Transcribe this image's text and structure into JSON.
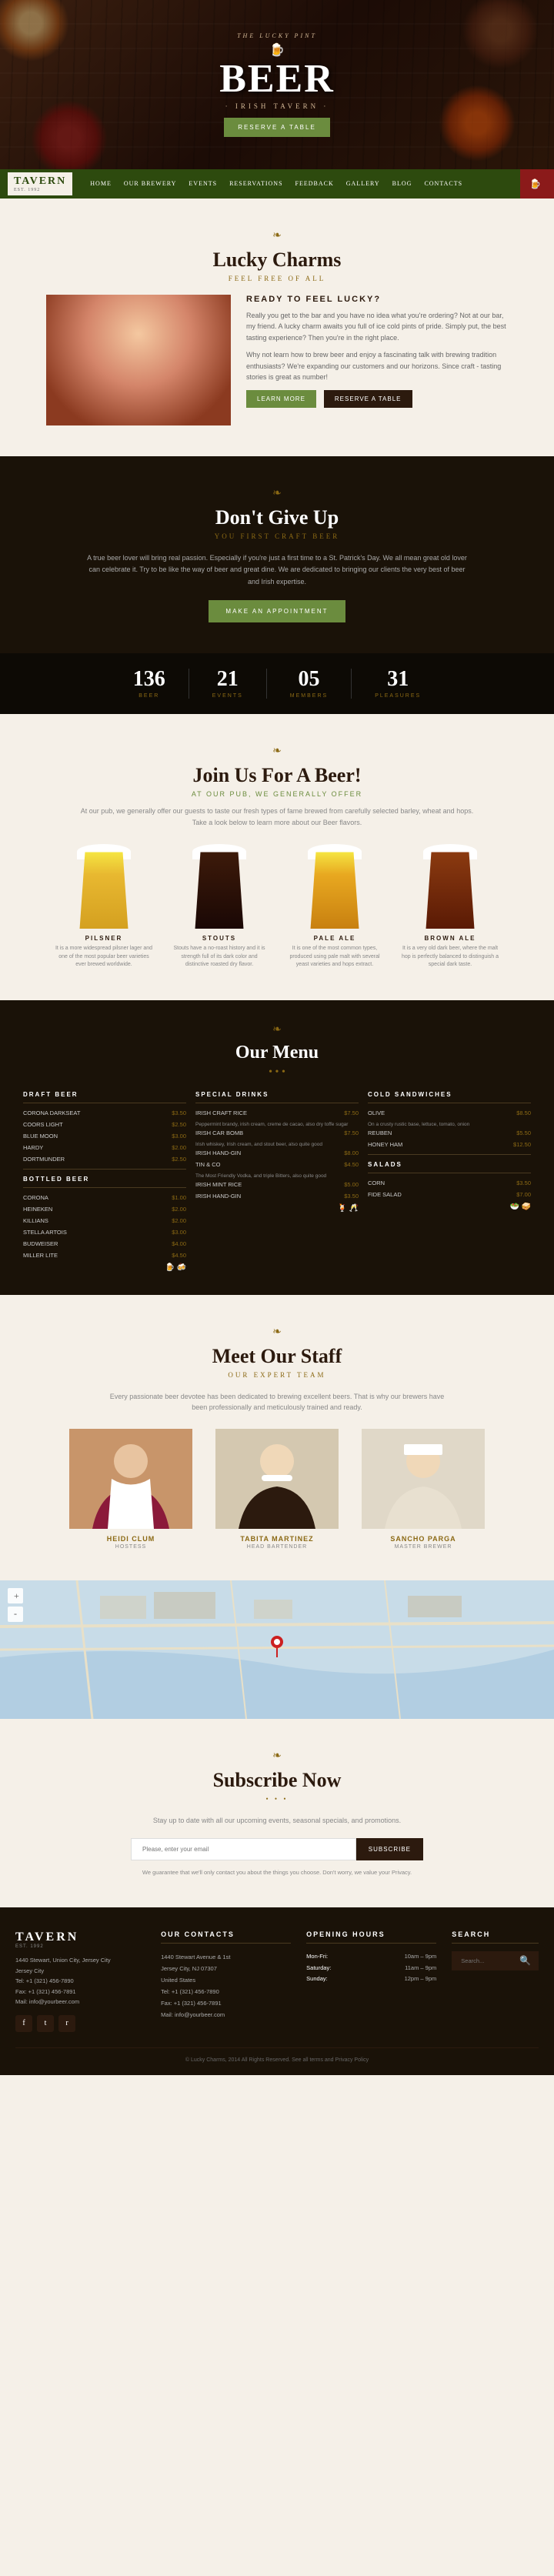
{
  "hero": {
    "brand_line": "THE LUCKY PINT",
    "title": "BEER",
    "subtitle": "· IRISH TAVERN ·",
    "cta_button": "RESERVE A TABLE"
  },
  "nav": {
    "logo": "TAVERN",
    "logo_sub": "EST. 1992",
    "items": [
      {
        "label": "HOME"
      },
      {
        "label": "OUR BREWERY"
      },
      {
        "label": "EVENTS"
      },
      {
        "label": "RESERVATIONS"
      },
      {
        "label": "FEEDBACK"
      },
      {
        "label": "GALLERY"
      },
      {
        "label": "BLOG"
      },
      {
        "label": "CONTACTS"
      }
    ],
    "ribbon": "CONTACTS"
  },
  "lucky_charms": {
    "section_title": "Lucky Charms",
    "section_subtitle": "FEEL FREE OF ALL",
    "ready_title": "READY TO FEEL LUCKY?",
    "paragraph1": "Really you get to the bar and you have no idea what you're ordering? Not at our bar, my friend. A lucky charm awaits you full of ice cold pints of pride. Simply put, the best tasting experience? Then you're in the right place.",
    "paragraph2": "Why not learn how to brew beer and enjoy a fascinating talk with brewing tradition enthusiasts? We're expanding our customers and our horizons. Since craft - tasting stories is great as number!",
    "btn1": "LEARN MORE",
    "btn2": "RESERVE A TABLE"
  },
  "dont_give_up": {
    "section_title": "Don't Give Up",
    "section_subtitle": "YOU FIRST CRAFT BEER",
    "paragraph": "A true beer lover will bring real passion. Especially if you're just a first time to a St. Patrick's Day. We all mean great old lover can celebrate it. Try to be like the way of beer and great dine. We are dedicated to bringing our clients the very best of beer and Irish expertise.",
    "cta_button": "MAKE AN APPOINTMENT"
  },
  "stats": [
    {
      "number": "136",
      "label": "BEER"
    },
    {
      "number": "21",
      "label": "EVENTS"
    },
    {
      "number": "05",
      "label": "MEMBERS"
    },
    {
      "number": "31",
      "label": "PLEASURES"
    }
  ],
  "join_beer": {
    "section_title": "Join Us For A Beer!",
    "section_subtitle": "AT OUR PUB, WE GENERALLY OFFER",
    "description": "At our pub, we generally offer our guests to taste our fresh types of fame brewed from carefully selected barley, wheat and hops. Take a look below to learn more about our Beer flavors.",
    "beers": [
      {
        "name": "PILSNER",
        "type": "pilsner",
        "description": "It is a more widespread pilsner lager and one of the most popular beer varieties ever brewed worldwide."
      },
      {
        "name": "STOUTS",
        "type": "stout",
        "description": "Stouts have a no-roast history and it is strength full of its dark color and distinctive roasted dry flavor."
      },
      {
        "name": "PALE ALE",
        "type": "pale",
        "description": "It is one of the most common types, produced using pale malt with several yeast varieties and hops extract."
      },
      {
        "name": "BROWN ALE",
        "type": "brown",
        "description": "It is a very old dark beer, where the malt hop is perfectly balanced to distinguish a special dark taste."
      }
    ]
  },
  "menu": {
    "section_title": "Our Menu",
    "columns": [
      {
        "title": "DRAFT BEER",
        "items": [
          {
            "name": "CORONA DARKSEAT",
            "price": "$3.50"
          },
          {
            "name": "COORS LIGHT",
            "price": "$2.50"
          },
          {
            "name": "BLUE MOON",
            "price": "$3.00"
          },
          {
            "name": "HARDY",
            "price": "$2.00"
          },
          {
            "name": "DORTMUNDER",
            "price": "$2.50"
          }
        ],
        "sub_title": "BOTTLED BEER",
        "sub_items": [
          {
            "name": "CORONA",
            "price": "$1.00"
          },
          {
            "name": "HEINEKEN",
            "price": "$2.00"
          },
          {
            "name": "KILLIANS",
            "price": "$2.00"
          },
          {
            "name": "STELLA ARTOIS",
            "price": "$3.00"
          },
          {
            "name": "BUDWEISER",
            "price": "$4.00"
          },
          {
            "name": "MILLER LITE",
            "price": "$4.50"
          }
        ]
      },
      {
        "title": "SPECIAL DRINKS",
        "items": [
          {
            "name": "IRISH CRAFT RICE",
            "price": "$7.50",
            "desc": "Peppermint brandy, irish cream, creme de cacao, also dry toffe sugar"
          },
          {
            "name": "IRISH CAR BOMB",
            "price": "$7.50",
            "desc": "Irish whiskey, Irish cream, and stout beer, also quite good"
          },
          {
            "name": "IRISH HAND-GIN",
            "price": "$8.00",
            "desc": ""
          },
          {
            "name": "TIN & CO",
            "price": "$4.50",
            "desc": "The Most Friendly Vodka, and triple Bitters, also quite good"
          },
          {
            "name": "IRISH MINT RICE",
            "price": "$5.00",
            "desc": ""
          },
          {
            "name": "IRISH HAND-GIN",
            "price": "$3.50",
            "desc": ""
          }
        ]
      },
      {
        "title": "COLD SANDWICHES",
        "items": [
          {
            "name": "OLIVE",
            "desc": "On a crusty rustic base, lettuce, tomato, onion",
            "price": "$8.50"
          },
          {
            "name": "REUBEN",
            "desc": "",
            "price": "$5.50"
          },
          {
            "name": "HONEY HAM",
            "desc": "",
            "price": "$12.50"
          }
        ],
        "sub_title": "SALADS",
        "sub_items": [
          {
            "name": "CORN",
            "desc": "",
            "price": "$3.50"
          },
          {
            "name": "FIDE SALAD",
            "desc": "",
            "price": "$7.00"
          }
        ]
      }
    ]
  },
  "staff": {
    "section_title": "Meet Our Staff",
    "description": "Every passionate beer devotee has been dedicated to brewing excellent beers. That is why our brewers have been professionally and meticulously trained and ready.",
    "members": [
      {
        "name": "HEIDI CLUM",
        "role": "HOSTESS"
      },
      {
        "name": "TABITA MARTINEZ",
        "role": "HEAD BARTENDER"
      },
      {
        "name": "SANCHO PARGA",
        "role": "MASTER BREWER"
      }
    ]
  },
  "subscribe": {
    "section_title": "Subscribe Now",
    "description": "Stay up to date with all our upcoming events, seasonal specials, and promotions.",
    "input_placeholder": "Please, enter your email",
    "btn_label": "SUBSCRIBE",
    "note": "We guarantee that we'll only contact you about the things you choose. Don't worry, we value your Privacy."
  },
  "footer": {
    "logo": "TAVERN",
    "logo_sub": "EST. 1992",
    "address_lines": [
      "1440 Stewart, Union City, Jersey City",
      "Jersey City",
      "Tel: +1 (321) 456-7890",
      "Fax: +1 (321) 456-7891",
      "Mail: info@yourbeer.com"
    ],
    "contacts_title": "OUR CONTACTS",
    "contacts_lines": [
      "1440 Stewart Avenue & 1st",
      "Jersey City, NJ 07307",
      "United States",
      "Tel: +1 (321) 456-7890",
      "Fax: +1 (321) 456-7891",
      "Mail: info@yourbeer.com"
    ],
    "hours_title": "OPENING HOURS",
    "hours": [
      {
        "day": "Mon-Fri:",
        "time": "10am – 9pm"
      },
      {
        "day": "Saturday:",
        "time": "11am – 9pm"
      },
      {
        "day": "Sunday:",
        "time": "12pm – 9pm"
      }
    ],
    "search_title": "SEARCH",
    "search_placeholder": "Search...",
    "bottom_text": "© Lucky Charms, 2014 All Rights Reserved. See all terms and Privacy Policy"
  }
}
